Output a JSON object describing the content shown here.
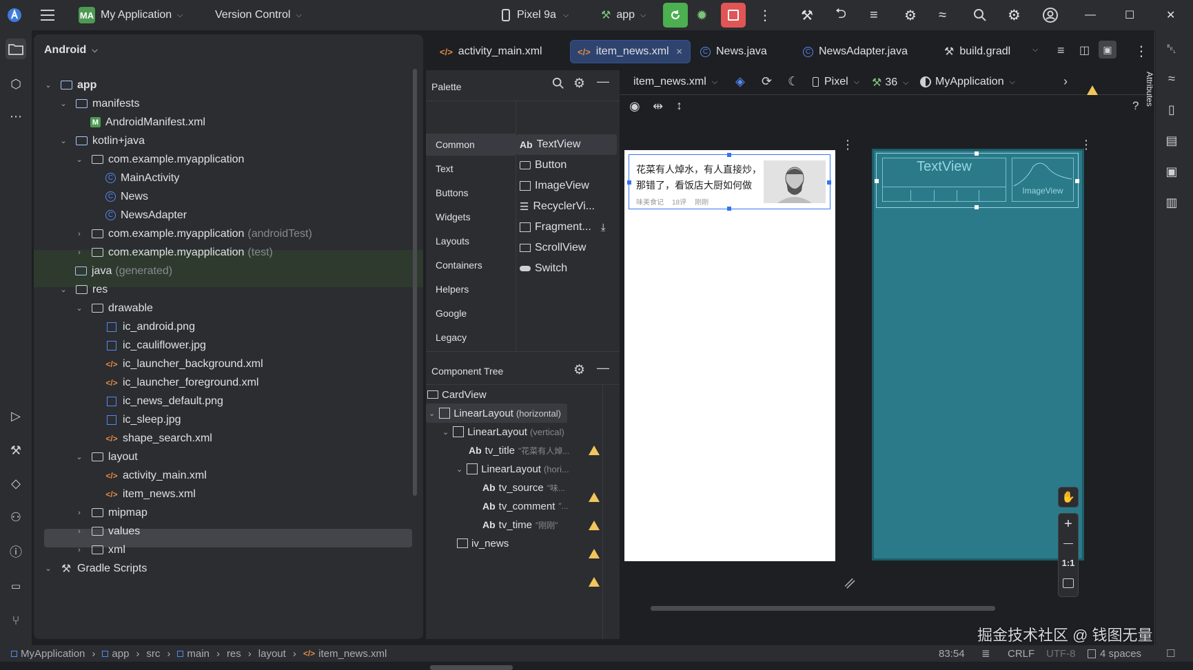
{
  "topbar": {
    "project_badge": "MA",
    "project_name": "My Application",
    "vcs": "Version Control",
    "device": "Pixel 9a",
    "run_config": "app",
    "win_min": "—",
    "win_max": "☐",
    "win_close": "✕"
  },
  "project_panel": {
    "view_mode": "Android",
    "rows": [
      {
        "label": "app",
        "suffix": ""
      },
      {
        "label": "manifests",
        "suffix": ""
      },
      {
        "label": "AndroidManifest.xml",
        "suffix": ""
      },
      {
        "label": "kotlin+java",
        "suffix": ""
      },
      {
        "label": "com.example.myapplication",
        "suffix": ""
      },
      {
        "label": "MainActivity",
        "suffix": ""
      },
      {
        "label": "News",
        "suffix": ""
      },
      {
        "label": "NewsAdapter",
        "suffix": ""
      },
      {
        "label": "com.example.myapplication",
        "suffix": "(androidTest)"
      },
      {
        "label": "com.example.myapplication",
        "suffix": "(test)"
      },
      {
        "label": "java",
        "suffix": "(generated)"
      },
      {
        "label": "res",
        "suffix": ""
      },
      {
        "label": "drawable",
        "suffix": ""
      },
      {
        "label": "ic_android.png",
        "suffix": ""
      },
      {
        "label": "ic_cauliflower.jpg",
        "suffix": ""
      },
      {
        "label": "ic_launcher_background.xml",
        "suffix": ""
      },
      {
        "label": "ic_launcher_foreground.xml",
        "suffix": ""
      },
      {
        "label": "ic_news_default.png",
        "suffix": ""
      },
      {
        "label": "ic_sleep.jpg",
        "suffix": ""
      },
      {
        "label": "shape_search.xml",
        "suffix": ""
      },
      {
        "label": "layout",
        "suffix": ""
      },
      {
        "label": "activity_main.xml",
        "suffix": ""
      },
      {
        "label": "item_news.xml",
        "suffix": ""
      },
      {
        "label": "mipmap",
        "suffix": ""
      },
      {
        "label": "values",
        "suffix": ""
      },
      {
        "label": "xml",
        "suffix": ""
      },
      {
        "label": "Gradle Scripts",
        "suffix": ""
      }
    ]
  },
  "tabs": [
    {
      "label": "activity_main.xml"
    },
    {
      "label": "item_news.xml"
    },
    {
      "label": "News.java"
    },
    {
      "label": "NewsAdapter.java"
    },
    {
      "label": "build.gradl"
    }
  ],
  "palette": {
    "title": "Palette",
    "categories": [
      "Common",
      "Text",
      "Buttons",
      "Widgets",
      "Layouts",
      "Containers",
      "Helpers",
      "Google",
      "Legacy"
    ],
    "items": [
      {
        "label": "TextView",
        "glyph": "Ab"
      },
      {
        "label": "Button",
        "glyph": ""
      },
      {
        "label": "ImageView",
        "glyph": ""
      },
      {
        "label": "RecyclerVi...",
        "glyph": ""
      },
      {
        "label": "Fragment...",
        "glyph": ""
      },
      {
        "label": "ScrollView",
        "glyph": ""
      },
      {
        "label": "Switch",
        "glyph": ""
      }
    ]
  },
  "component_tree": {
    "title": "Component Tree",
    "rows": [
      {
        "label": "CardView",
        "hint": "",
        "prefix": ""
      },
      {
        "label": "LinearLayout",
        "hint": "(horizontal)",
        "prefix": ""
      },
      {
        "label": "LinearLayout",
        "hint": "(vertical)",
        "prefix": ""
      },
      {
        "label": "tv_title",
        "hint": "\"花菜有人焯...",
        "prefix": "Ab"
      },
      {
        "label": "LinearLayout",
        "hint": "(hori...",
        "prefix": ""
      },
      {
        "label": "tv_source",
        "hint": "\"味...",
        "prefix": "Ab"
      },
      {
        "label": "tv_comment",
        "hint": "\"...",
        "prefix": "Ab"
      },
      {
        "label": "tv_time",
        "hint": "\"刚刚\"",
        "prefix": "Ab"
      },
      {
        "label": "iv_news",
        "hint": "",
        "prefix": ""
      }
    ]
  },
  "design_toolbar": {
    "file": "item_news.xml",
    "device": "Pixel",
    "api": "36",
    "theme": "MyApplication"
  },
  "preview": {
    "title_line1": "花菜有人焯水，有人直接炒，",
    "title_line2": "那错了，看饭店大厨如何做",
    "source": "味美食记",
    "comment": "18评",
    "time": "刚刚"
  },
  "blueprint": {
    "textview_label": "TextView",
    "imageview_label": "ImageView"
  },
  "attributes_label": "Attributes",
  "zoom": {
    "ratio": "1:1",
    "plus": "+",
    "minus": "—"
  },
  "statusbar": {
    "crumbs": [
      "MyApplication",
      "app",
      "src",
      "main",
      "res",
      "layout",
      "item_news.xml"
    ],
    "position": "83:54",
    "line_sep": "CRLF",
    "encoding": "UTF-8",
    "indent": "4 spaces"
  },
  "watermark": "掘金技术社区 @ 钱图无量",
  "colors": {
    "accent": "#3574f0",
    "run": "#4caf50",
    "stop": "#e05555",
    "warning": "#f2c55c",
    "blueprint": "#2a7a8a"
  }
}
